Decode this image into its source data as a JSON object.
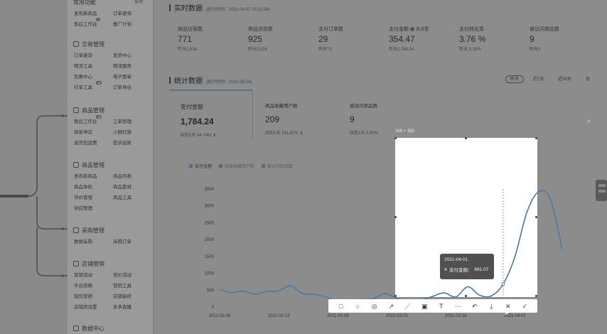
{
  "sidebar": {
    "groups": [
      {
        "title": "常用功能",
        "has_icon": false,
        "rows": [
          [
            "发布新商品",
            "订单查询"
          ],
          [
            "售后工作台",
            "推广计划"
          ]
        ],
        "badges": {
          "0": "",
          "1": "2"
        }
      },
      {
        "title": "交易管理",
        "has_icon": true,
        "rows": [
          [
            "订单查询",
            "发货中心"
          ],
          [
            "物流工具",
            "物流服务"
          ],
          [
            "包裹中心",
            "电子面单"
          ],
          [
            "打单工具",
            "订单导出"
          ]
        ],
        "badges": {
          "3": "38"
        }
      },
      {
        "title": "商品管理",
        "has_icon": true,
        "rows": [
          [
            "售后工作台",
            "工单管理"
          ],
          [
            "商家申证",
            "小额打款"
          ],
          [
            "退货包运费",
            "投诉退款"
          ]
        ],
        "badges": {
          "0": "38"
        }
      },
      {
        "title": "商品管理",
        "has_icon": true,
        "rows": [
          [
            "发布新商品",
            "商品列表"
          ],
          [
            "商品体检",
            "商品素材"
          ],
          [
            "评价管理",
            "商品工具"
          ],
          [
            "供应管理",
            ""
          ]
        ],
        "badges": {}
      },
      {
        "title": "采购管理",
        "has_icon": true,
        "rows": [
          [
            "数据采购",
            "采购订单"
          ]
        ],
        "badges": {}
      },
      {
        "title": "店铺营销",
        "has_icon": true,
        "rows": [
          [
            "营销活动",
            "竞价活动"
          ],
          [
            "平台资格",
            "营销工具"
          ],
          [
            "短信营销",
            "店铺装修"
          ],
          [
            "店铺页设置",
            "多多直播"
          ]
        ],
        "badges": {}
      },
      {
        "title": "数据中心",
        "has_icon": true,
        "rows": [],
        "badges": {}
      }
    ],
    "top_right_label": "管理"
  },
  "realtime": {
    "title": "实时数据",
    "subtitle": "(统计时间：2021-04-07 15:12:54)",
    "cards": [
      {
        "label": "商品访客数",
        "value": "771",
        "compare": "昨天1,634",
        "help": false
      },
      {
        "label": "商品浏览数",
        "value": "925",
        "compare": "昨天2,024",
        "help": false
      },
      {
        "label": "支付订单数",
        "value": "29",
        "compare": "昨天73",
        "help": false
      },
      {
        "label": "支付金额",
        "value": "354.47",
        "compare": "昨天1,784.24",
        "help": true,
        "extra": "去设置"
      },
      {
        "label": "支付转化率",
        "value": "3.76 %",
        "compare": "昨天 4.39%",
        "help": false
      },
      {
        "label": "被访问商品数",
        "value": "9",
        "compare": "昨天9",
        "help": false
      }
    ]
  },
  "stats": {
    "title": "统计数据",
    "subtitle": "(统计时间：2021-04-06)",
    "range_tabs": [
      {
        "label": "昨天",
        "active": true
      },
      {
        "label": "近7天",
        "active": false
      },
      {
        "label": "近30天",
        "active": false
      },
      {
        "label": "日",
        "active": false
      }
    ],
    "cards": [
      {
        "label": "支付金额",
        "value": "1,784.24",
        "compare_label": "较前1天",
        "compare": "44.74%",
        "active": true
      },
      {
        "label": "商品收藏用户数",
        "value": "209",
        "compare_label": "较前1天",
        "compare": "191.87%",
        "active": false
      },
      {
        "label": "被访问商品数",
        "value": "9",
        "compare_label": "较前1天",
        "compare": "0.00%",
        "active": false
      }
    ],
    "legend": [
      {
        "label": "支付金额",
        "active": true
      },
      {
        "label": "商品收藏用户数",
        "active": false
      },
      {
        "label": "被访问商品数",
        "active": false
      }
    ]
  },
  "capture": {
    "dimensions": "348 × 393",
    "close_label": "×",
    "toolbar": [
      "□",
      "○",
      "◎",
      "↗",
      "／",
      "▣",
      "T",
      "···",
      "↶",
      "⤓",
      "✕",
      "✓"
    ]
  },
  "tooltip": {
    "date": "2021-04-01",
    "series": "支付金额：",
    "value": "681.07"
  },
  "chart_data": {
    "type": "line",
    "x": [
      "2021-03-08",
      "2021-03-09",
      "2021-03-10",
      "2021-03-11",
      "2021-03-12",
      "2021-03-13",
      "2021-03-14",
      "2021-03-15",
      "2021-03-16",
      "2021-03-17",
      "2021-03-18",
      "2021-03-19",
      "2021-03-20",
      "2021-03-21",
      "2021-03-22",
      "2021-03-23",
      "2021-03-24",
      "2021-03-25",
      "2021-03-26",
      "2021-03-27",
      "2021-03-28",
      "2021-03-29",
      "2021-03-30",
      "2021-03-31",
      "2021-04-01",
      "2021-04-02",
      "2021-04-03",
      "2021-04-04",
      "2021-04-05",
      "2021-04-06"
    ],
    "x_tick_labels": [
      "2021-03-08",
      "2021-03-13",
      "2021-03-18",
      "2021-03-23",
      "2021-03-28",
      "2021-04-02"
    ],
    "series": [
      {
        "name": "支付金额",
        "values": [
          520,
          430,
          470,
          380,
          460,
          480,
          630,
          400,
          370,
          300,
          160,
          150,
          220,
          250,
          400,
          250,
          150,
          200,
          310,
          420,
          300,
          600,
          350,
          330,
          681,
          1500,
          2800,
          3420,
          3200,
          1700
        ]
      }
    ],
    "y_ticks": [
      0,
      500,
      1000,
      1500,
      2000,
      2500,
      3000,
      3500
    ],
    "ylim": [
      0,
      3500
    ],
    "color": "#4a7aa3",
    "grid": false
  }
}
